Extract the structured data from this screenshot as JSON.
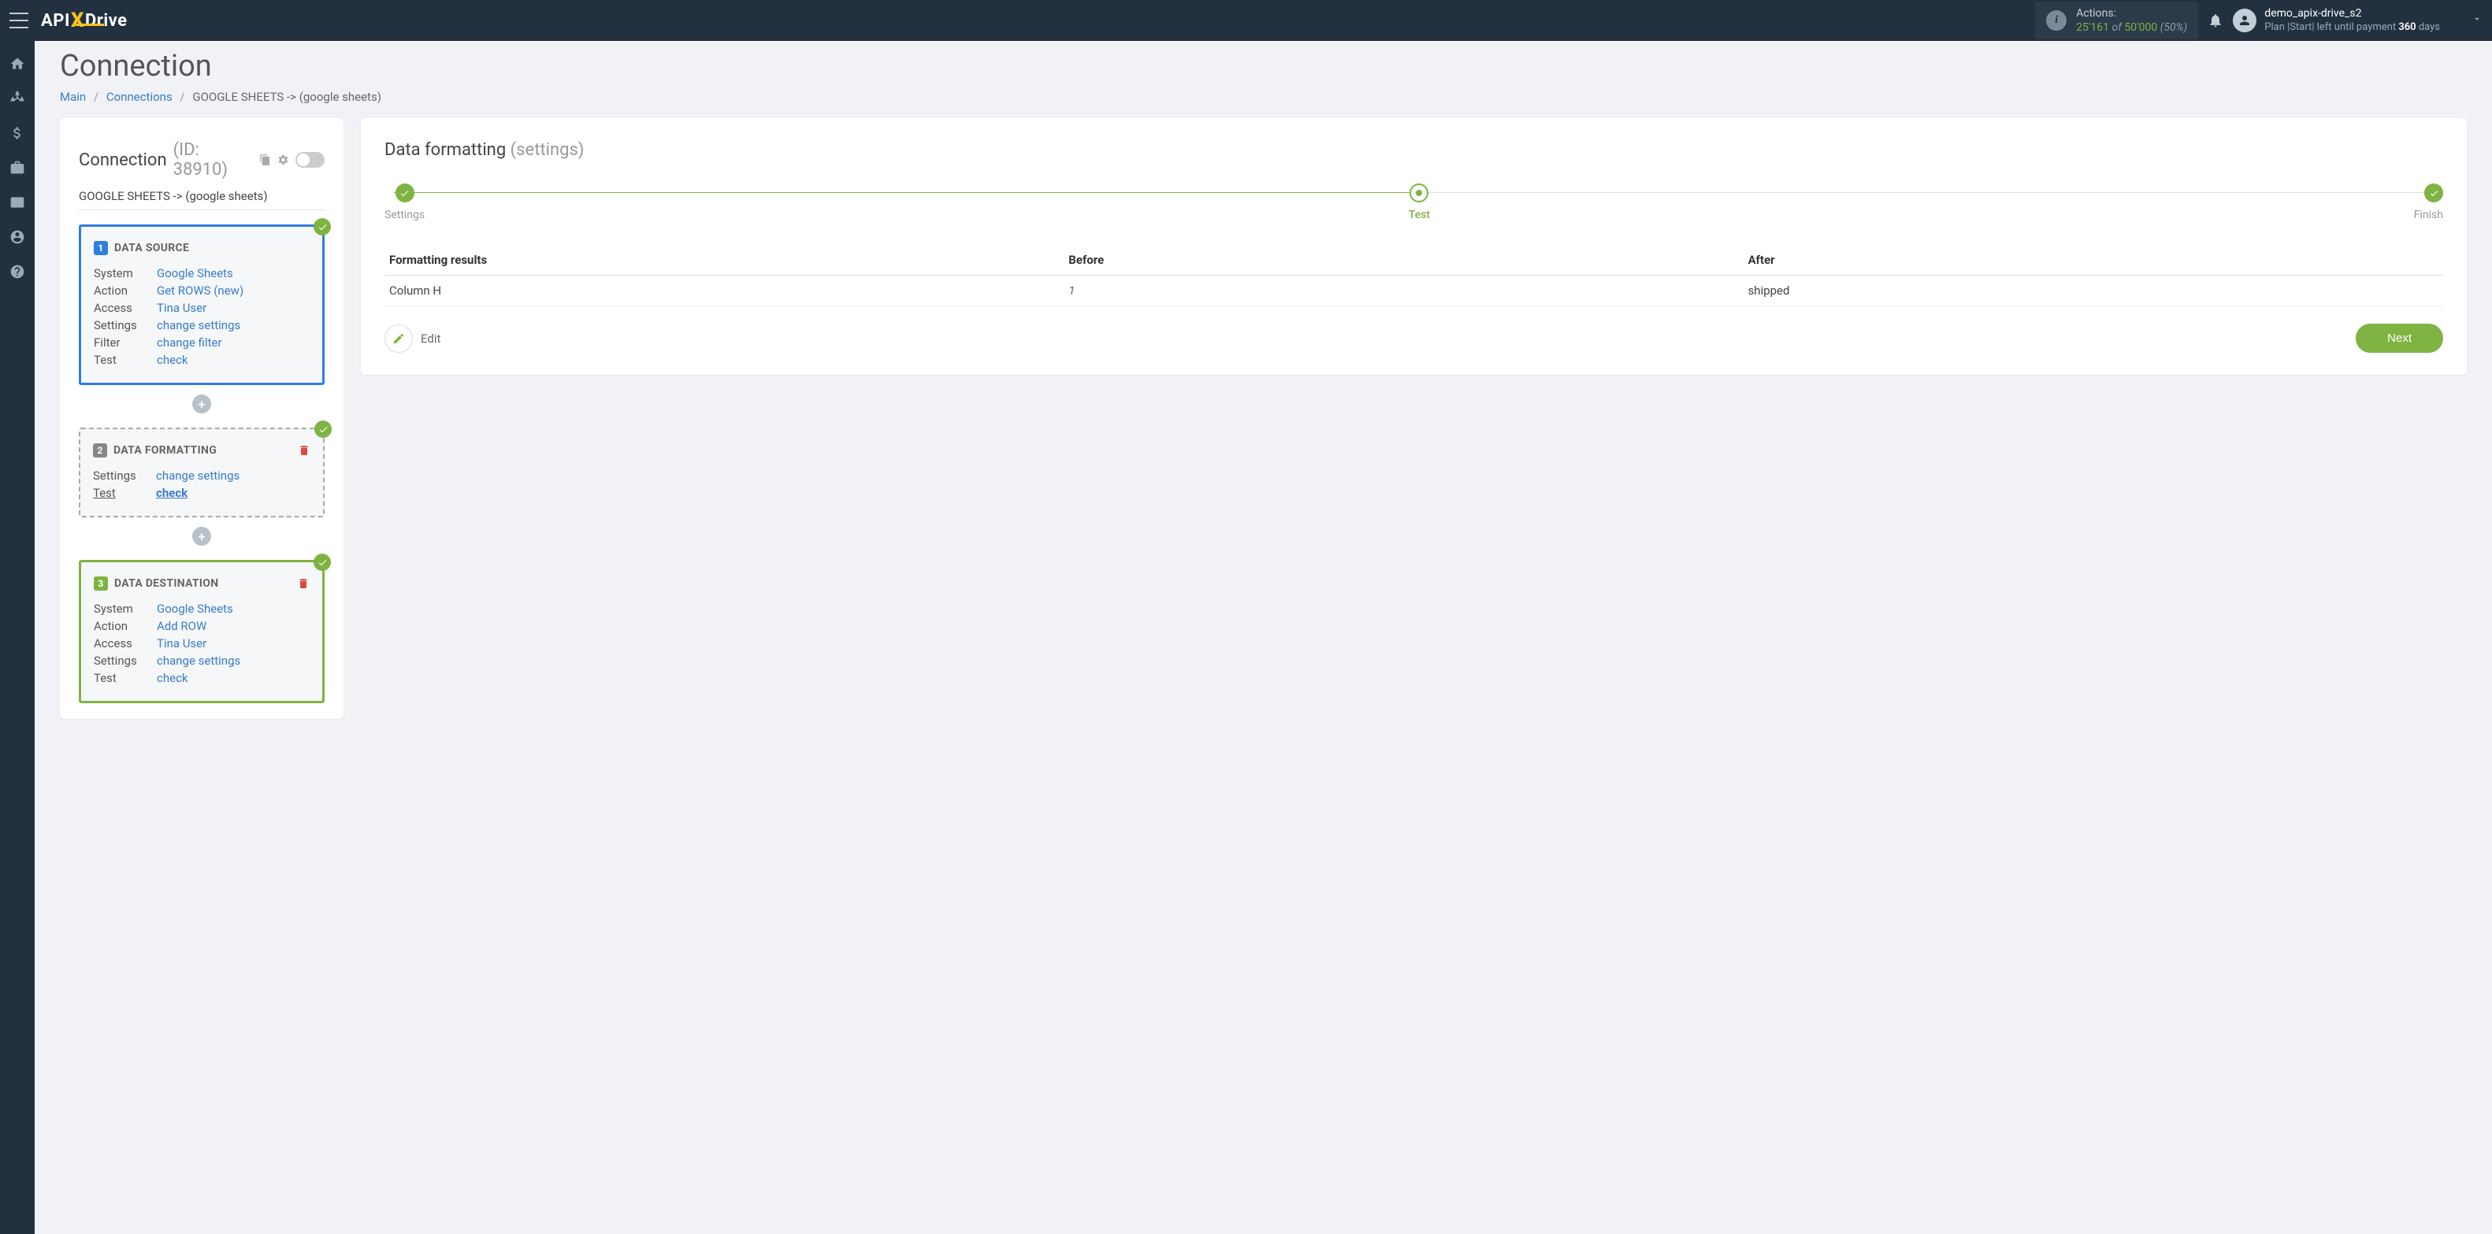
{
  "header": {
    "actions_label": "Actions:",
    "actions_used": "25'161",
    "actions_of": "of",
    "actions_total": "50'000",
    "actions_pct": "(50%)",
    "user_name": "demo_apix-drive_s2",
    "plan_prefix": "Plan |Start| left until payment ",
    "plan_days": "360",
    "plan_suffix": " days"
  },
  "page": {
    "title": "Connection",
    "crumb_main": "Main",
    "crumb_conn": "Connections",
    "crumb_current": "GOOGLE SHEETS -> (google sheets)"
  },
  "left": {
    "title": "Connection",
    "id": "(ID: 38910)",
    "sub": "GOOGLE SHEETS -> (google sheets)",
    "source": {
      "header": "DATA SOURCE",
      "rows": [
        {
          "key": "System",
          "val": "Google Sheets"
        },
        {
          "key": "Action",
          "val": "Get ROWS (new)"
        },
        {
          "key": "Access",
          "val": "Tina User"
        },
        {
          "key": "Settings",
          "val": "change settings"
        },
        {
          "key": "Filter",
          "val": "change filter"
        },
        {
          "key": "Test",
          "val": "check"
        }
      ]
    },
    "format": {
      "header": "DATA FORMATTING",
      "rows": [
        {
          "key": "Settings",
          "val": "change settings"
        },
        {
          "key": "Test",
          "val": "check"
        }
      ]
    },
    "dest": {
      "header": "DATA DESTINATION",
      "rows": [
        {
          "key": "System",
          "val": "Google Sheets"
        },
        {
          "key": "Action",
          "val": "Add ROW"
        },
        {
          "key": "Access",
          "val": "Tina User"
        },
        {
          "key": "Settings",
          "val": "change settings"
        },
        {
          "key": "Test",
          "val": "check"
        }
      ]
    }
  },
  "right": {
    "title": "Data formatting",
    "subtitle": "(settings)",
    "steps": {
      "settings": "Settings",
      "test": "Test",
      "finish": "Finish"
    },
    "th_results": "Formatting results",
    "th_before": "Before",
    "th_after": "After",
    "td_col": "Column H",
    "td_before": "1",
    "td_after": "shipped",
    "edit": "Edit",
    "next": "Next"
  }
}
